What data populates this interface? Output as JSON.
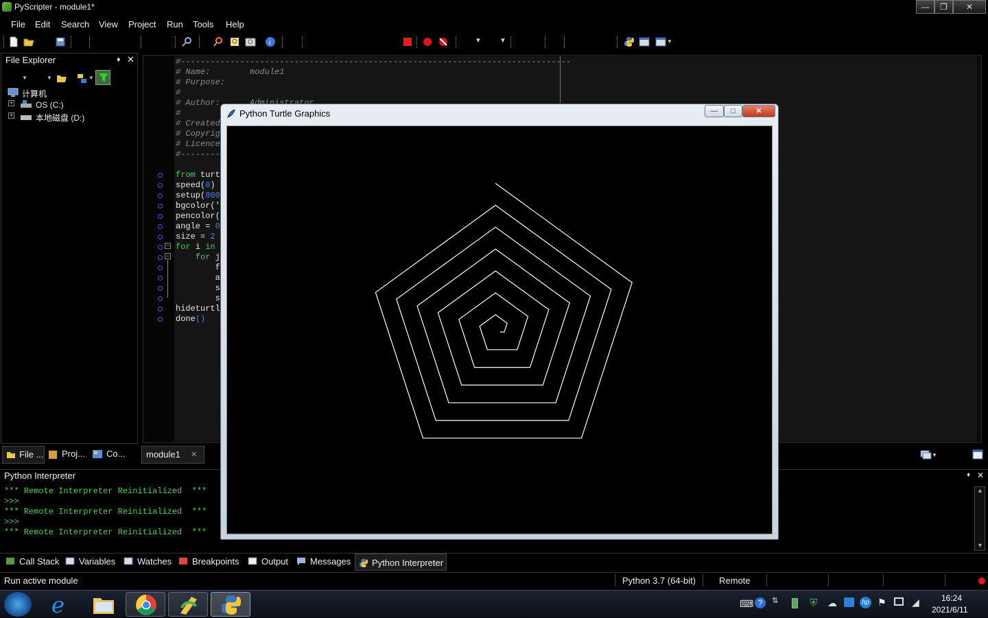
{
  "window": {
    "title": "PyScripter - module1*"
  },
  "menu": [
    "File",
    "Edit",
    "Search",
    "View",
    "Project",
    "Run",
    "Tools",
    "Help"
  ],
  "file_explorer": {
    "title": "File Explorer",
    "tree": [
      {
        "label": "计算机"
      },
      {
        "label": "OS (C:)"
      },
      {
        "label": "本地磁盘 (D:)"
      }
    ],
    "tabs": [
      "File ...",
      "Proj...",
      "Co..."
    ]
  },
  "editor": {
    "tab": "module1",
    "header_lines": [
      "#-------------------------------------------------------------------------------",
      "# Name:        module1",
      "# Purpose:",
      "#",
      "# Author:      Administrator",
      "#",
      "# Created",
      "# Copyrig",
      "# Licence",
      "#--------"
    ],
    "code_lines": [
      {
        "kw": "from",
        "rest": " turt"
      },
      {
        "kw": "",
        "rest": "speed(",
        "num": "0",
        "tail": ")"
      },
      {
        "kw": "",
        "rest": "setup(",
        "num": "800",
        "tail": ""
      },
      {
        "kw": "",
        "rest": "bgcolor('",
        "num": "",
        "tail": ""
      },
      {
        "kw": "",
        "rest": "pencolor(",
        "num": "",
        "tail": ""
      },
      {
        "kw": "",
        "rest": "angle = ",
        "num": "0",
        "tail": ""
      },
      {
        "kw": "",
        "rest": "size = ",
        "num": "2",
        "tail": ""
      },
      {
        "kw": "for",
        "rest": " i ",
        "kw2": "in",
        "tail": ""
      },
      {
        "kw": "    for",
        "rest": " j",
        "num": "",
        "tail": ""
      },
      {
        "kw": "",
        "rest": "        f",
        "num": "",
        "tail": ""
      },
      {
        "kw": "",
        "rest": "        a",
        "num": "",
        "tail": ""
      },
      {
        "kw": "",
        "rest": "        s",
        "num": "",
        "tail": ""
      },
      {
        "kw": "",
        "rest": "        s",
        "num": "",
        "tail": ""
      },
      {
        "kw": "",
        "rest": "hideturtl",
        "num": "",
        "tail": ""
      },
      {
        "kw": "",
        "rest": "done",
        "num": "()",
        "tail": ""
      }
    ]
  },
  "interpreter": {
    "title": "Python Interpreter",
    "lines": [
      "*** Remote Interpreter Reinitialized  ***",
      ">>>",
      "*** Remote Interpreter Reinitialized  ***",
      ">>>",
      "*** Remote Interpreter Reinitialized  ***"
    ]
  },
  "bottom_tabs": [
    "Call Stack",
    "Variables",
    "Watches",
    "Breakpoints",
    "Output",
    "Messages",
    "Python Interpreter"
  ],
  "status": {
    "left": "Run active module",
    "python": "Python 3.7 (64-bit)",
    "engine": "Remote"
  },
  "turtle_window": {
    "title": "Python Turtle Graphics"
  },
  "clock": {
    "time": "16:24",
    "date": "2021/6/11"
  }
}
